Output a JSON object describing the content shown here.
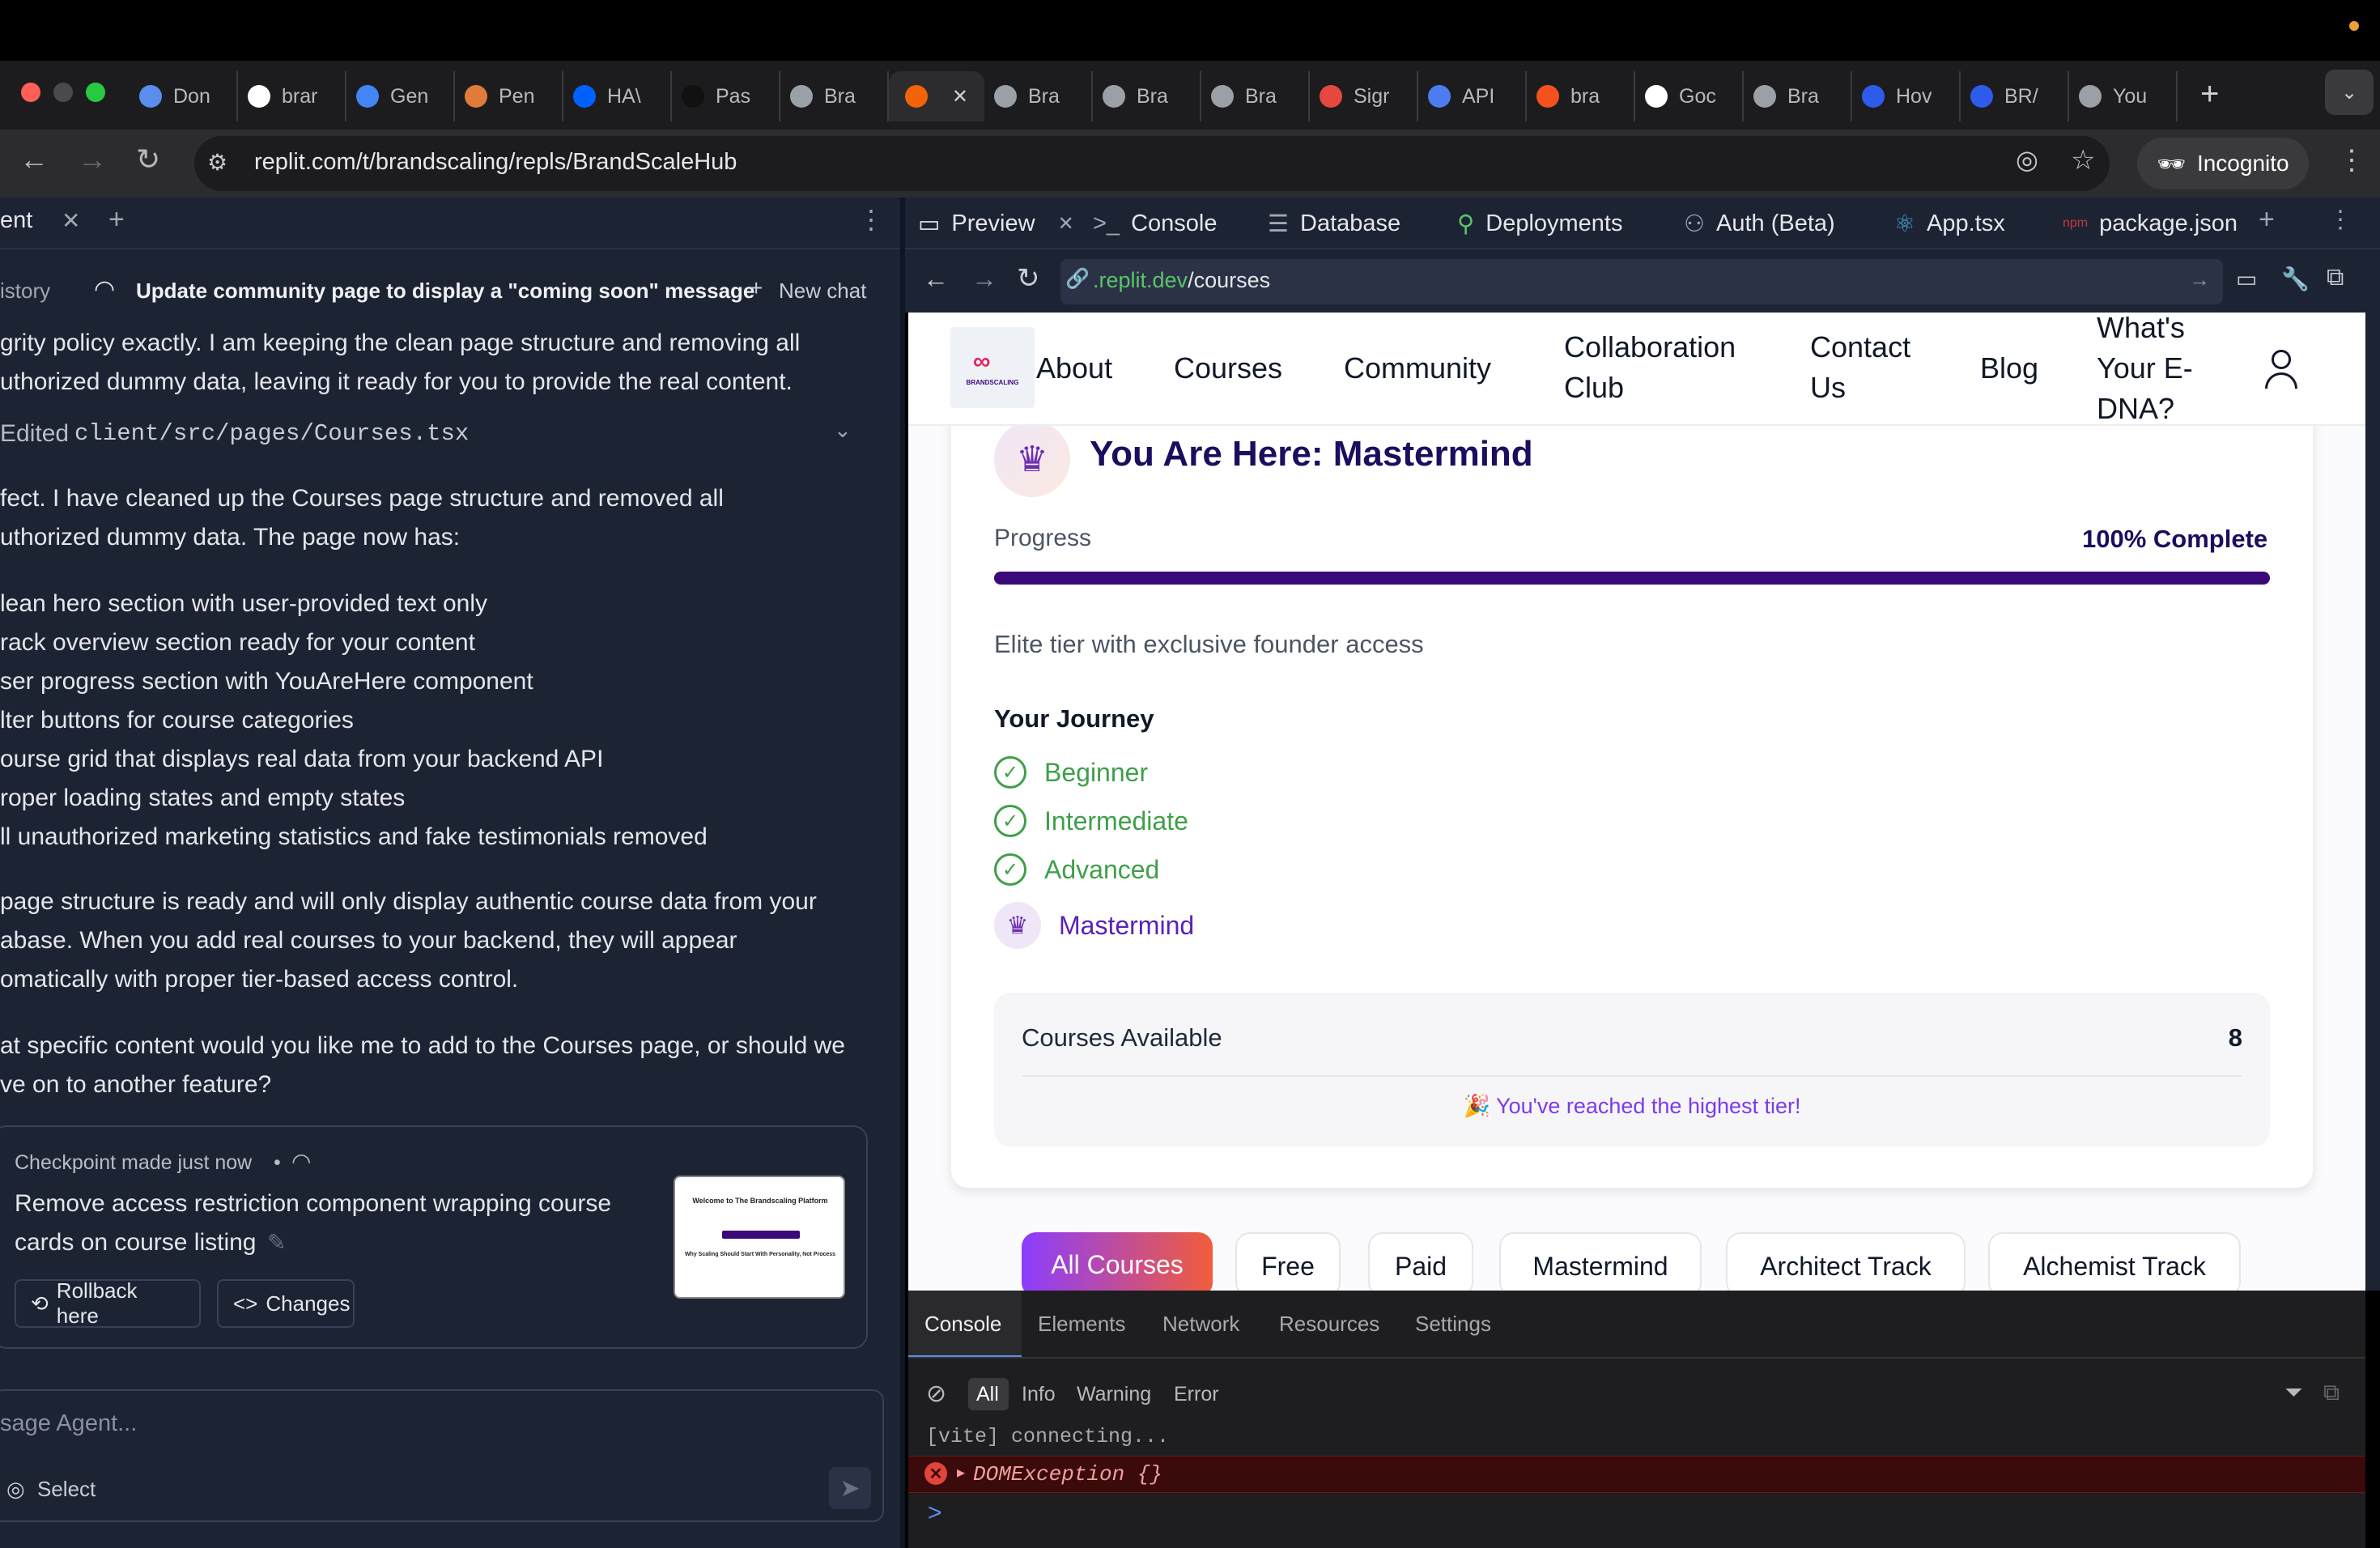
{
  "browser": {
    "tabs": [
      {
        "label": "Don",
        "icon": "clock-icon",
        "color": "#5b8def"
      },
      {
        "label": "brar",
        "icon": "brand-icon",
        "color": "#ffffff"
      },
      {
        "label": "Gen",
        "icon": "sparkle-icon",
        "color": "#4285f4"
      },
      {
        "label": "Pen",
        "icon": "pen-icon",
        "color": "#e07b39"
      },
      {
        "label": "HA\\",
        "icon": "dropbox-icon",
        "color": "#0061ff"
      },
      {
        "label": "Pas",
        "icon": "upwork-icon",
        "color": "#111111"
      },
      {
        "label": "Bra",
        "icon": "globe-icon",
        "color": "#9aa0a6"
      },
      {
        "label": "",
        "icon": "replit-icon",
        "color": "#f26207",
        "active": true
      },
      {
        "label": "Bra",
        "icon": "globe-icon",
        "color": "#9aa0a6"
      },
      {
        "label": "Bra",
        "icon": "globe-icon",
        "color": "#9aa0a6"
      },
      {
        "label": "Bra",
        "icon": "globe-icon",
        "color": "#9aa0a6"
      },
      {
        "label": "Sigr",
        "icon": "sign-icon",
        "color": "#e5483f"
      },
      {
        "label": "API",
        "icon": "openai-icon",
        "color": "#4c7cf0"
      },
      {
        "label": "bra",
        "icon": "flame-icon",
        "color": "#f4511e"
      },
      {
        "label": "Goc",
        "icon": "google-icon",
        "color": "#ffffff"
      },
      {
        "label": "Bra",
        "icon": "globe-icon",
        "color": "#9aa0a6"
      },
      {
        "label": "Hov",
        "icon": "arrow-icon",
        "color": "#2f5bea"
      },
      {
        "label": "BR/",
        "icon": "arrow-icon",
        "color": "#2f5bea"
      },
      {
        "label": "You",
        "icon": "globe-icon",
        "color": "#9aa0a6"
      }
    ],
    "url": "replit.com/t/brandscaling/repls/BrandScaleHub",
    "incognito": "Incognito"
  },
  "agent": {
    "tab_label": "ent",
    "history": "istory",
    "chat_title": "Update community page to display a \"coming soon\" message",
    "new_chat": "New chat",
    "lines": [
      "grity policy exactly. I am keeping the clean page structure and removing all",
      "uthorized dummy data, leaving it ready for you to provide the real content."
    ],
    "edited_prefix": "Edited",
    "edited_file": "client/src/pages/Courses.tsx",
    "para2": [
      "fect. I have cleaned up the Courses page structure and removed all",
      "uthorized dummy data. The page now has:"
    ],
    "bullets": [
      "lean hero section with user-provided text only",
      "rack overview section ready for your content",
      "ser progress section with YouAreHere component",
      "lter buttons for course categories",
      "ourse grid that displays real data from your backend API",
      "roper loading states and empty states",
      "ll unauthorized marketing statistics and fake testimonials removed"
    ],
    "para3": [
      "page structure is ready and will only display authentic course data from your",
      "abase. When you add real courses to your backend, they will appear",
      "omatically with proper tier-based access control."
    ],
    "para4": [
      "at specific content would you like me to add to the Courses page, or should we",
      "ve on to another feature?"
    ],
    "checkpoint": {
      "meta": "Checkpoint made just now",
      "dot": "•",
      "title_lines": [
        "Remove access restriction component wrapping course",
        "cards on course listing"
      ],
      "rollback": "Rollback here",
      "changes": "Changes",
      "thumb_title": "Welcome to The Brandscaling Platform",
      "thumb_sub": "Why Scaling Should Start With Personality, Not Process"
    },
    "input_placeholder": "sage Agent...",
    "select": "Select"
  },
  "workspace": {
    "tabs": [
      "Preview",
      "Console",
      "Database",
      "Deployments",
      "Auth (Beta)",
      "App.tsx",
      "package.json"
    ],
    "preview_url_domain": ".replit.dev",
    "preview_url_path": "/courses"
  },
  "site": {
    "logo_text": "BRANDSCALING",
    "nav": {
      "about": "About",
      "courses": "Courses",
      "community": "Community",
      "collab": [
        "Collaboration",
        "Club"
      ],
      "contact": [
        "Contact",
        "Us"
      ],
      "blog": "Blog",
      "edna": [
        "What's",
        "Your E-",
        "DNA?"
      ]
    },
    "you_are_here": "You Are Here: Mastermind",
    "progress_label": "Progress",
    "progress_value": "100% Complete",
    "progress_fraction": 1.0,
    "tier_desc": "Elite tier with exclusive founder access",
    "journey_title": "Your Journey",
    "journey": [
      "Beginner",
      "Intermediate",
      "Advanced"
    ],
    "journey_current": "Mastermind",
    "courses_available_label": "Courses Available",
    "courses_available_count": "8",
    "highest_tier": "🎉 You've reached the highest tier!",
    "filters": [
      "All Courses",
      "Free",
      "Paid",
      "Mastermind",
      "Architect Track",
      "Alchemist Track"
    ],
    "colors": {
      "accent": "#3b0a7a",
      "green": "#3f9f4a",
      "purple": "#7c3aed",
      "active_filter": "#8b3dff"
    }
  },
  "devtools": {
    "tabs": [
      "Console",
      "Elements",
      "Network",
      "Resources",
      "Settings"
    ],
    "levels": [
      "All",
      "Info",
      "Warning",
      "Error"
    ],
    "log": "[vite] connecting...",
    "error": "DOMException {}",
    "prompt": ">"
  }
}
